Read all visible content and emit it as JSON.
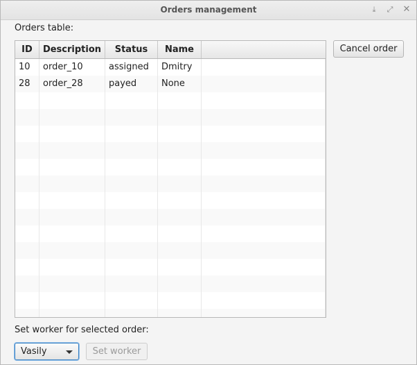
{
  "window": {
    "title": "Orders management"
  },
  "labels": {
    "orders_table": "Orders table:",
    "set_worker": "Set worker for selected order:"
  },
  "table": {
    "columns": [
      "ID",
      "Description",
      "Status",
      "Name"
    ],
    "rows": [
      {
        "id": "10",
        "description": "order_10",
        "status": "assigned",
        "name": "Dmitry"
      },
      {
        "id": "28",
        "description": "order_28",
        "status": "payed",
        "name": "None"
      }
    ]
  },
  "buttons": {
    "cancel_order": "Cancel order",
    "set_worker": "Set worker"
  },
  "worker_select": {
    "selected": "Vasily"
  },
  "icons": {
    "minimize": "minimize-icon",
    "maximize": "maximize-icon",
    "close": "close-icon"
  }
}
